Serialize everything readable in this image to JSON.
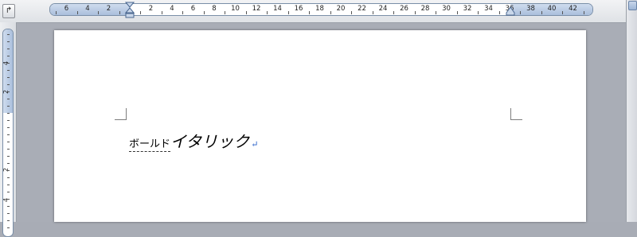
{
  "ruler": {
    "h_numbers_left": [
      "6",
      "4",
      "2"
    ],
    "h_numbers_right": [
      "2",
      "4",
      "6",
      "8",
      "10",
      "12",
      "14",
      "16",
      "18",
      "20",
      "22",
      "24",
      "26",
      "28",
      "30",
      "32",
      "34",
      "36",
      "38",
      "40",
      "42"
    ],
    "v_numbers": [
      "4",
      "2",
      "2",
      "4"
    ]
  },
  "tab_selector": {
    "symbol": "↱"
  },
  "document": {
    "bold_text": "ボールド",
    "italic_text": "イタリック",
    "paragraph_mark": "↵"
  }
}
